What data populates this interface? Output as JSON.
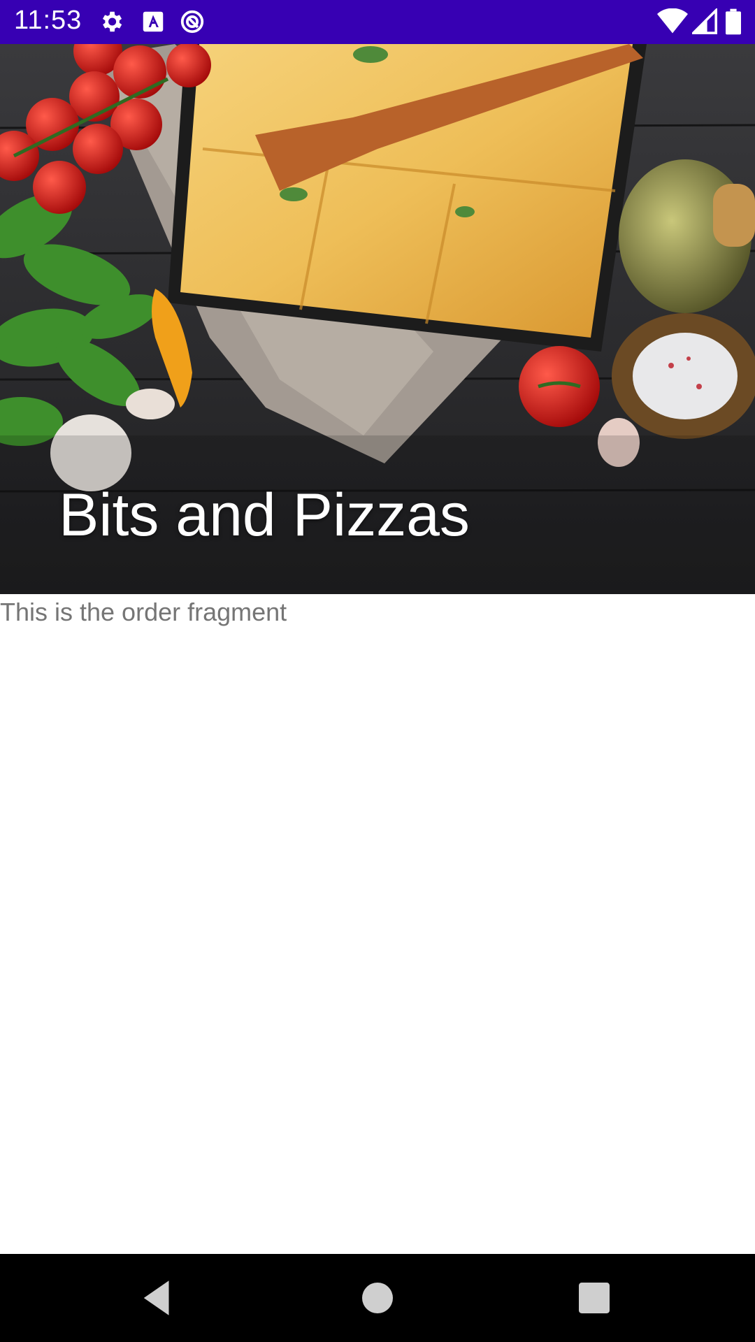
{
  "status_bar": {
    "time": "11:53",
    "icons": [
      "settings-icon",
      "font-a-icon",
      "data-saver-icon",
      "wifi-icon",
      "signal-icon",
      "battery-icon"
    ],
    "background": "#3700b3"
  },
  "toolbar": {
    "title": "Bits and Pizzas"
  },
  "content": {
    "fragment_text": "This is the order fragment"
  },
  "nav_bar": {
    "buttons": [
      "back-icon",
      "home-icon",
      "recents-icon"
    ]
  }
}
